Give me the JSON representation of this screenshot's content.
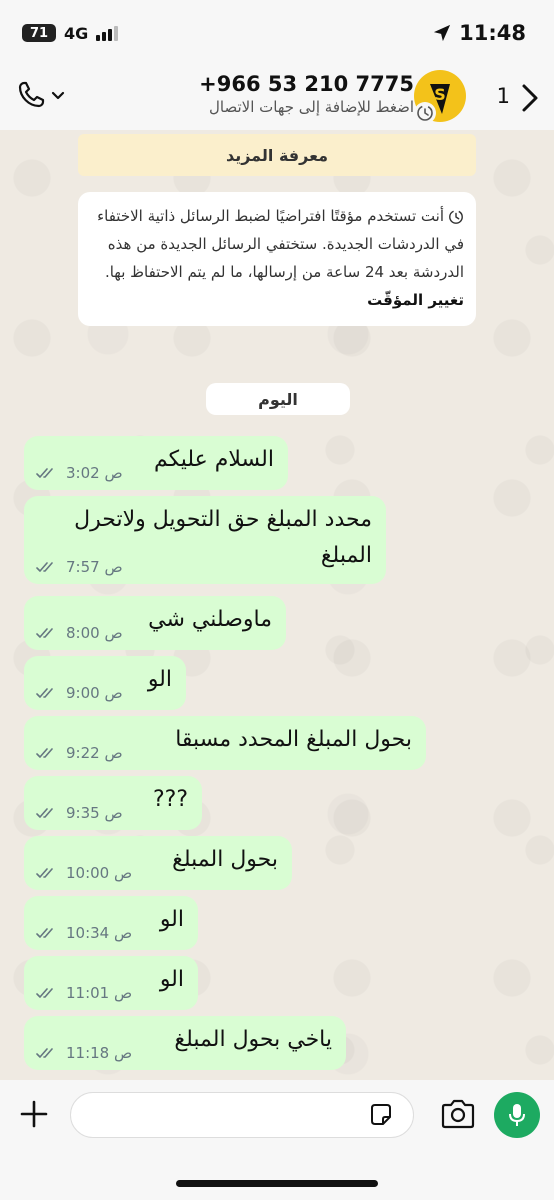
{
  "status_bar": {
    "battery": "71",
    "network": "4G",
    "time": "11:48"
  },
  "header": {
    "contact_number": "+966 53 210 7775",
    "contact_subtitle": "اضغط للإضافة إلى جهات الاتصال",
    "back_count": "1"
  },
  "banner": {
    "learn_more": "معرفة المزيد"
  },
  "notice": {
    "text": "أنت تستخدم مؤقتًا افتراضيًا لضبط الرسائل ذاتية الاختفاء في الدردشات الجديدة. ستختفي الرسائل الجديدة من هذه الدردشة بعد 24 ساعة من إرسالها، ما لم يتم الاحتفاظ بها.",
    "change_timer": "تغيير المؤقّت"
  },
  "day_label": "اليوم",
  "messages": [
    {
      "text": "السلام عليكم",
      "time": "3:02 ص"
    },
    {
      "text": "محدد المبلغ حق التحويل ولاتحرل المبلغ",
      "time": "7:57 ص"
    },
    {
      "text": "ماوصلني شي",
      "time": "8:00 ص"
    },
    {
      "text": "الو",
      "time": "9:00 ص"
    },
    {
      "text": "بحول المبلغ المحدد مسبقا",
      "time": "9:22 ص"
    },
    {
      "text": "???",
      "time": "9:35 ص"
    },
    {
      "text": "بحول المبلغ",
      "time": "10:00 ص"
    },
    {
      "text": "الو",
      "time": "10:34 ص"
    },
    {
      "text": "الو",
      "time": "11:01 ص"
    },
    {
      "text": "ياخي بحول المبلغ",
      "time": "11:18 ص"
    }
  ],
  "input": {
    "placeholder": ""
  },
  "colors": {
    "bubble_out": "#d9fdd3",
    "chat_bg": "#efeae2",
    "accent_green": "#1daa61",
    "banner_bg": "#fbefcc"
  }
}
